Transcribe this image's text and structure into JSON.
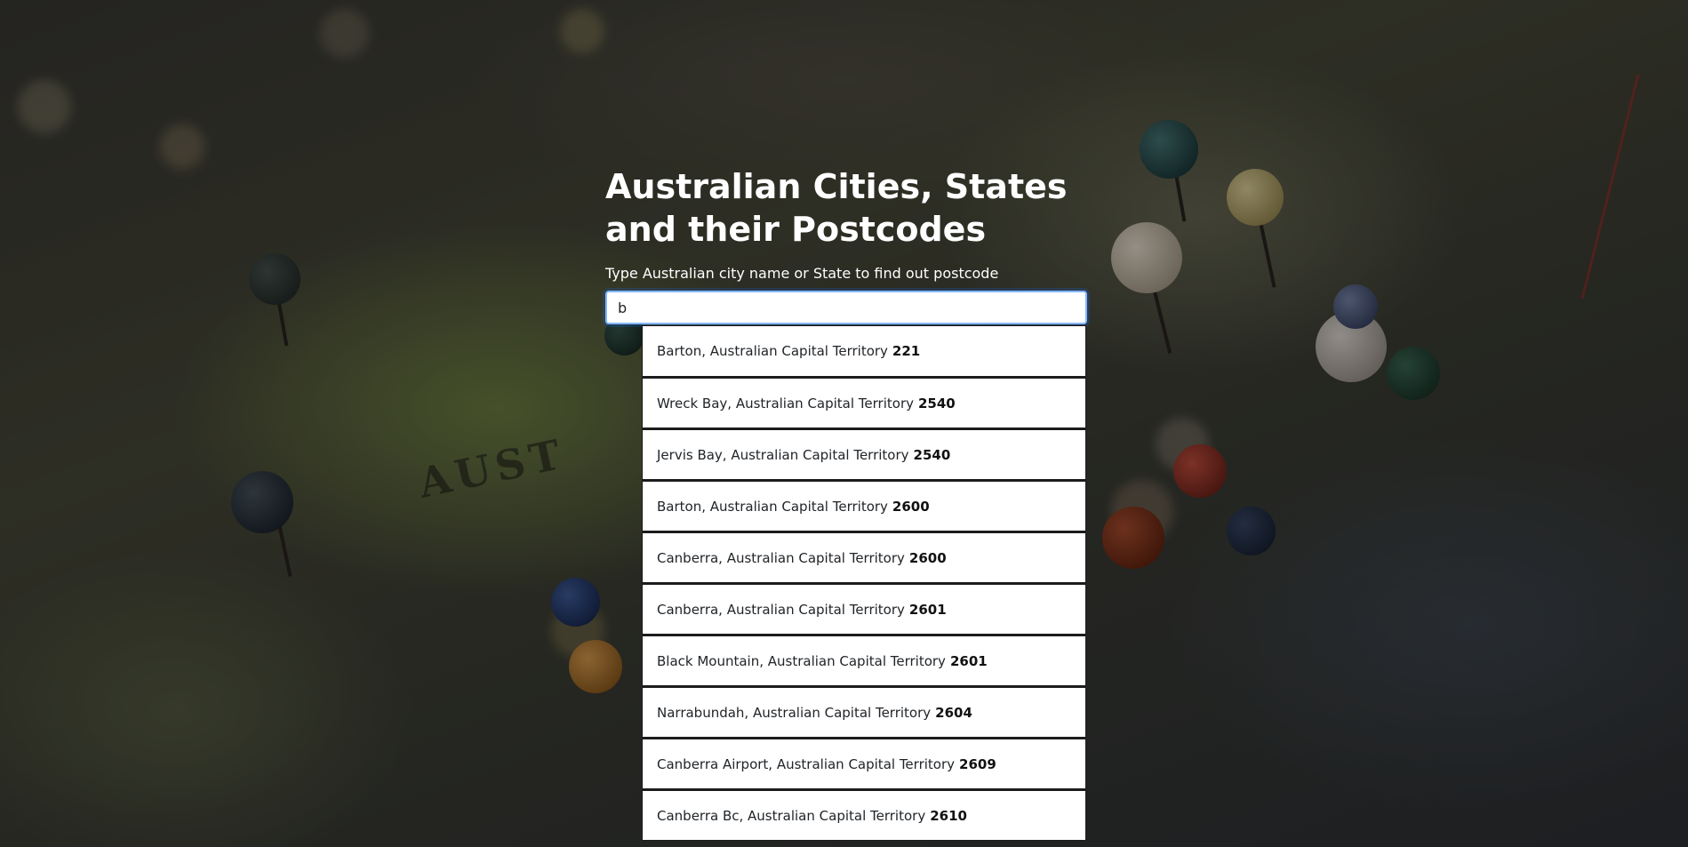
{
  "page": {
    "title": "Australian Cities, States and their Postcodes",
    "subtitle": "Type Australian city name or State to find out postcode"
  },
  "search": {
    "value": "b",
    "placeholder": ""
  },
  "background": {
    "map_label": "AUST"
  },
  "results": [
    {
      "place": "Barton, Australian Capital Territory",
      "postcode": "221"
    },
    {
      "place": "Wreck Bay, Australian Capital Territory",
      "postcode": "2540"
    },
    {
      "place": "Jervis Bay, Australian Capital Territory",
      "postcode": "2540"
    },
    {
      "place": "Barton, Australian Capital Territory",
      "postcode": "2600"
    },
    {
      "place": "Canberra, Australian Capital Territory",
      "postcode": "2600"
    },
    {
      "place": "Canberra, Australian Capital Territory",
      "postcode": "2601"
    },
    {
      "place": "Black Mountain, Australian Capital Territory",
      "postcode": "2601"
    },
    {
      "place": "Narrabundah, Australian Capital Territory",
      "postcode": "2604"
    },
    {
      "place": "Canberra Airport, Australian Capital Territory",
      "postcode": "2609"
    },
    {
      "place": "Canberra Bc, Australian Capital Territory",
      "postcode": "2610"
    }
  ],
  "colors": {
    "focus_border": "#86b7fe",
    "title_text": "#ffffff",
    "result_background": "#ffffff"
  }
}
